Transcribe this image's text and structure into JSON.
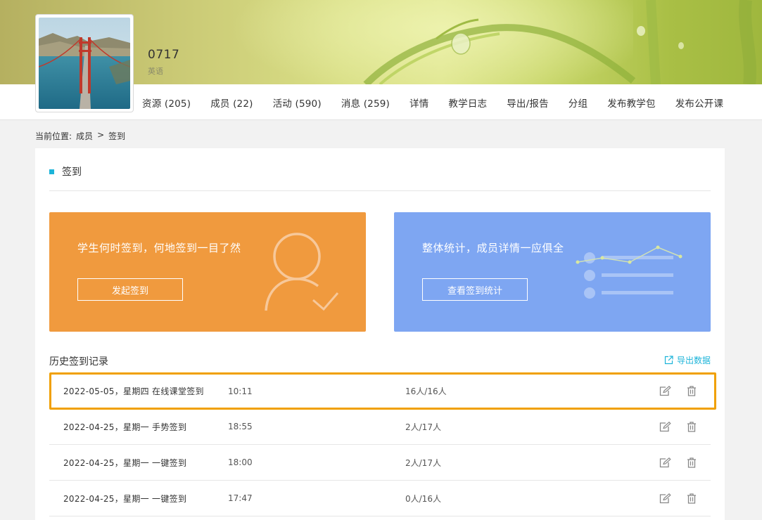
{
  "course": {
    "title": "0717",
    "subject": "英语"
  },
  "nav": {
    "items": [
      {
        "label": "资源 (205)"
      },
      {
        "label": "成员 (22)"
      },
      {
        "label": "活动 (590)"
      },
      {
        "label": "消息 (259)"
      },
      {
        "label": "详情"
      },
      {
        "label": "教学日志"
      },
      {
        "label": "导出/报告"
      },
      {
        "label": "分组"
      },
      {
        "label": "发布教学包"
      },
      {
        "label": "发布公开课"
      }
    ]
  },
  "breadcrumb": {
    "prefix": "当前位置:",
    "level1": "成员",
    "separator": ">",
    "level2": "签到"
  },
  "section": {
    "title": "签到"
  },
  "promo_left": {
    "text": "学生何时签到，何地签到一目了然",
    "button": "发起签到",
    "color": "#f09a3e",
    "icon": "person-check-icon"
  },
  "promo_right": {
    "text": "整体统计，成员详情一应俱全",
    "button": "查看签到统计",
    "color": "#7ea6f2",
    "icon": "stats-list-icon"
  },
  "history": {
    "title": "历史签到记录",
    "export_label": "导出数据",
    "rows": [
      {
        "date": "2022-05-05，星期四 在线课堂签到",
        "time": "10:11",
        "count": "16人/16人",
        "highlighted": true
      },
      {
        "date": "2022-04-25，星期一 手势签到",
        "time": "18:55",
        "count": "2人/17人",
        "highlighted": false
      },
      {
        "date": "2022-04-25，星期一 一键签到",
        "time": "18:00",
        "count": "2人/17人",
        "highlighted": false
      },
      {
        "date": "2022-04-25，星期一 一键签到",
        "time": "17:47",
        "count": "0人/16人",
        "highlighted": false
      }
    ]
  },
  "colors": {
    "accent": "#1db4d9",
    "highlight_border": "#f0a000"
  }
}
